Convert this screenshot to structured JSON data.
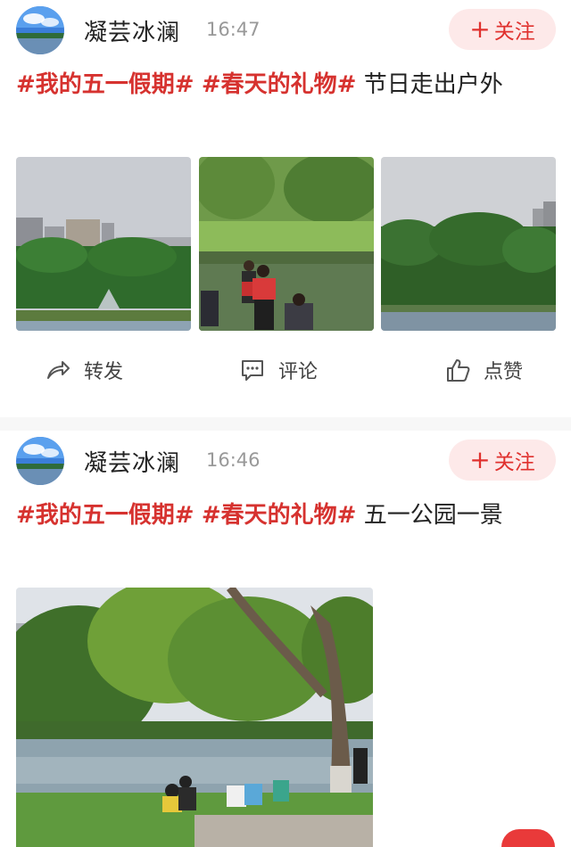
{
  "colors": {
    "accent": "#e0312e",
    "tag": "#d6322f",
    "follow_bg": "#fde9e9",
    "muted": "#999999"
  },
  "posts": [
    {
      "username": "凝芸冰澜",
      "time": "16:47",
      "follow_label": "关注",
      "tags": [
        "#我的五一假期#",
        "#春天的礼物#"
      ],
      "text": "节日走出户外",
      "images": [
        "city-skyline-park",
        "lakeside-people",
        "lake-trees"
      ],
      "actions": {
        "repost": "转发",
        "comment": "评论",
        "like": "点赞"
      }
    },
    {
      "username": "凝芸冰澜",
      "time": "16:46",
      "follow_label": "关注",
      "tags": [
        "#我的五一假期#",
        "#春天的礼物#"
      ],
      "text": "五一公园一景",
      "images": [
        "willow-lake-park"
      ]
    }
  ],
  "icons": [
    "avatar",
    "plus-icon",
    "share-icon",
    "comment-icon",
    "like-icon"
  ]
}
